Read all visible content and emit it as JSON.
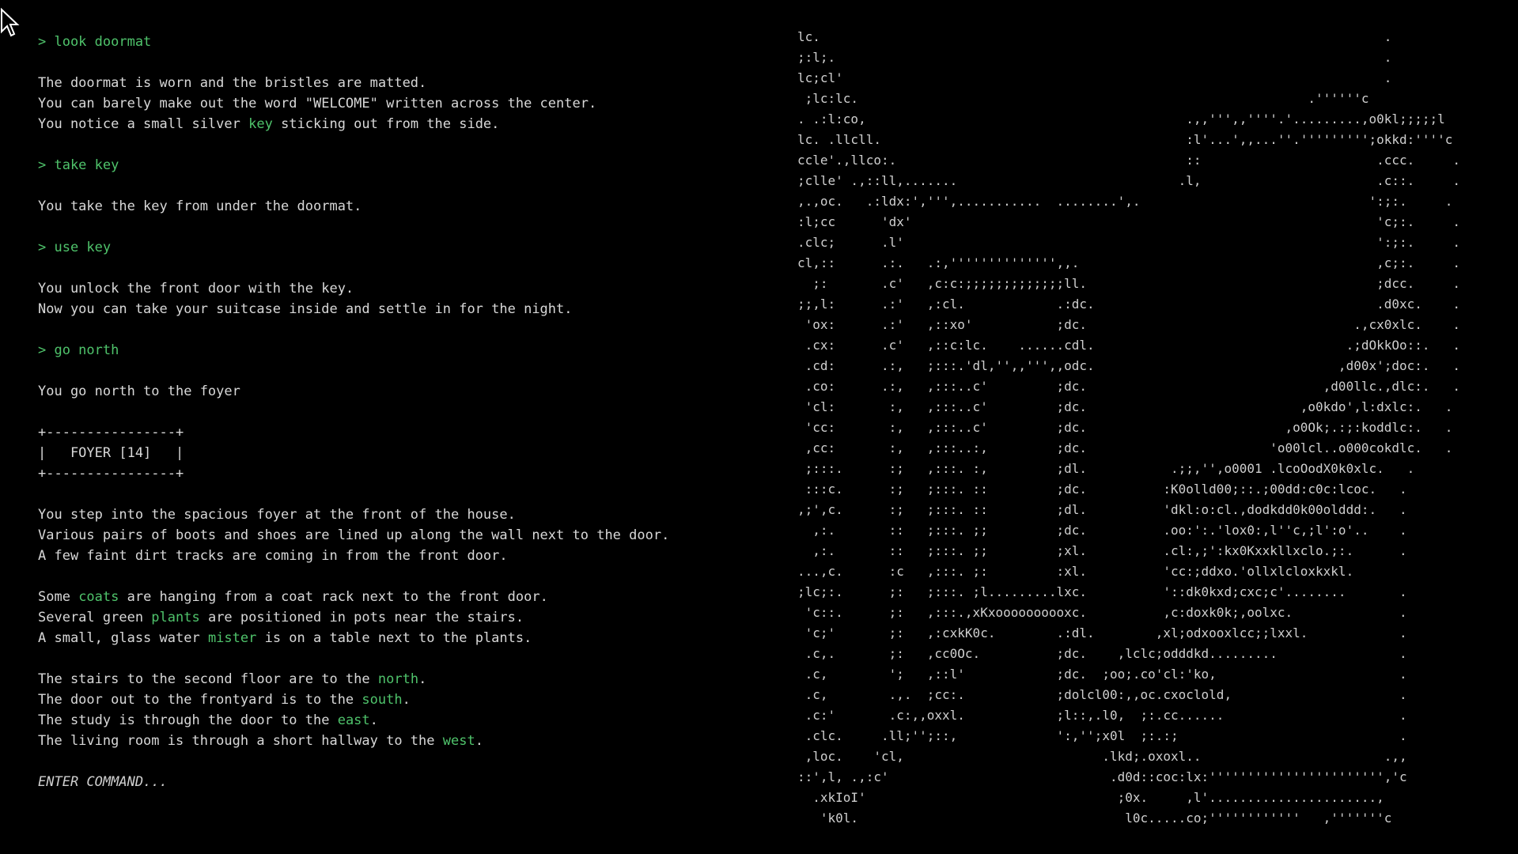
{
  "terminal": {
    "blocks": [
      {
        "type": "cmd",
        "text": "> look doormat"
      },
      {
        "type": "blank"
      },
      {
        "type": "text",
        "parts": [
          {
            "t": "The doormat is worn and the bristles are matted."
          }
        ]
      },
      {
        "type": "text",
        "parts": [
          {
            "t": "You can barely make out the word \"WELCOME\" written across the center."
          }
        ]
      },
      {
        "type": "text",
        "parts": [
          {
            "t": "You notice a small silver "
          },
          {
            "t": "key",
            "hl": true
          },
          {
            "t": " sticking out from the side."
          }
        ]
      },
      {
        "type": "blank"
      },
      {
        "type": "cmd",
        "text": "> take key"
      },
      {
        "type": "blank"
      },
      {
        "type": "text",
        "parts": [
          {
            "t": "You take the key from under the doormat."
          }
        ]
      },
      {
        "type": "blank"
      },
      {
        "type": "cmd",
        "text": "> use key"
      },
      {
        "type": "blank"
      },
      {
        "type": "text",
        "parts": [
          {
            "t": "You unlock the front door with the key."
          }
        ]
      },
      {
        "type": "text",
        "parts": [
          {
            "t": "Now you can take your suitcase inside and settle in for the night."
          }
        ]
      },
      {
        "type": "blank"
      },
      {
        "type": "cmd",
        "text": "> go north"
      },
      {
        "type": "blank"
      },
      {
        "type": "text",
        "parts": [
          {
            "t": "You go north to the foyer"
          }
        ]
      },
      {
        "type": "blank"
      },
      {
        "type": "box",
        "text": "+----------------+"
      },
      {
        "type": "box",
        "text": "|   FOYER [14]   |"
      },
      {
        "type": "box",
        "text": "+----------------+"
      },
      {
        "type": "blank"
      },
      {
        "type": "text",
        "parts": [
          {
            "t": "You step into the spacious foyer at the front of the house."
          }
        ]
      },
      {
        "type": "text",
        "parts": [
          {
            "t": "Various pairs of boots and shoes are lined up along the wall next to the door."
          }
        ]
      },
      {
        "type": "text",
        "parts": [
          {
            "t": "A few faint dirt tracks are coming in from the front door."
          }
        ]
      },
      {
        "type": "blank"
      },
      {
        "type": "text",
        "parts": [
          {
            "t": "Some "
          },
          {
            "t": "coats",
            "hl": true
          },
          {
            "t": " are hanging from a coat rack next to the front door."
          }
        ]
      },
      {
        "type": "text",
        "parts": [
          {
            "t": "Several green "
          },
          {
            "t": "plants",
            "hl": true
          },
          {
            "t": " are positioned in pots near the stairs."
          }
        ]
      },
      {
        "type": "text",
        "parts": [
          {
            "t": "A small, glass water "
          },
          {
            "t": "mister",
            "hl": true
          },
          {
            "t": " is on a table next to the plants."
          }
        ]
      },
      {
        "type": "blank"
      },
      {
        "type": "text",
        "parts": [
          {
            "t": "The stairs to the second floor are to the "
          },
          {
            "t": "north",
            "hl": true
          },
          {
            "t": "."
          }
        ]
      },
      {
        "type": "text",
        "parts": [
          {
            "t": "The door out to the frontyard is to the "
          },
          {
            "t": "south",
            "hl": true
          },
          {
            "t": "."
          }
        ]
      },
      {
        "type": "text",
        "parts": [
          {
            "t": "The study is through the door to the "
          },
          {
            "t": "east",
            "hl": true
          },
          {
            "t": "."
          }
        ]
      },
      {
        "type": "text",
        "parts": [
          {
            "t": "The living room is through a short hallway to the "
          },
          {
            "t": "west",
            "hl": true
          },
          {
            "t": "."
          }
        ]
      },
      {
        "type": "blank"
      },
      {
        "type": "prompt",
        "text": "ENTER COMMAND..."
      }
    ]
  },
  "ascii_art": [
    "lc.                                                                          .",
    ";:l;.                                                                        .",
    "lc;cl'                                                                       .",
    " ;lc:lc.                                                           .''''''c",
    ". .:l:co,                                          .,,''',,''''.'.........,o0kl;;;;;l",
    "lc. .llcll.                                        :l'...',,...''.''''''''';okkd:''''c",
    "ccle'.,llco:.                                      ::                       .ccc.     .",
    ";clle' .,::ll,.......                             .l,                       .c::.     .",
    ",.,oc.   .:ldx:',''',...........  ........',.                              ':;:.     .",
    ":l;cc      'dx'                                                             'c;:.     .",
    ".clc;      .l'                                                              ':;:.     .",
    "cl,::      .:.   .:,'''''''''''''',,.                                       ,c;:.     .",
    "  ;:       .c'   ,c:c:;;;;;;;;;;;;;ll.                                      ;dcc.     .",
    ";;,l:      .:'   ,:cl.            .:dc.                                     .d0xc.    .",
    " 'ox:      .:'   ,::xo'           ;dc.                                   .,cx0xlc.    .",
    " .cx:      .c'   ,::c:lc.    ......cdl.                                 .;dOkkOo::.   .",
    " .cd:      .:,   ;:::.'dl,'',,''',,odc.                                ,d00x';doc:.   .",
    " .co:      .:,   ,:::..c'         ;dc.                               ,d00llc.,dlc:.   .",
    " 'cl:       :,   ,:::..c'         ;dc.                            ,o0kdo',l:dxlc:.   .",
    " 'cc:       :,   ,:::..c'         ;dc.                          ,o0Ok;.:;:koddlc:.   .",
    " ,cc:       :,   ,:::..:,         ;dc.                        'o00lcl..o000cokdlc.   .",
    " ;:::.      :;   ,:::. :,         ;dl.           .;;,'',o0001 .lcoOodX0k0xlc.   .",
    " :::c.      :;   ;:::. ::         ;dc.          :K0olld00;::.;00dd:c0c:lcoc.   .",
    ",;',c.      :;   ;:::. ::         ;dl.          'dkl:o:cl.,dodkdd0k00olddd:.   .",
    "  ,:.       ::   ;:::. ;;         ;dc.          .oo:':.'lox0:,l''c,;l':o'..    .",
    "  ,:.       ::   ;:::. ;;         ;xl.          .cl:,;':kx0Kxxkllxclo.;:.      .",
    "...,c.      :c   ,:::. ;:         :xl.          'cc:;ddxo.'ollxlcloxkxkl.       ",
    ";lc;:.      ;:   ;:::. ;l.........lxc.          '::dk0kxd;cxc;c'........       .",
    " 'c::.      ;:   ,:::.,xKxoooooooooxc.          ,c:doxk0k;,oolxc.              .",
    " 'c;'       ;:   ,:cxkK0c.        .:dl.        ,xl;odxooxlcc;;lxxl.            .",
    " .c,.       ;:   ,cc0Oc.          ;dc.    ,lclc;odddkd.........                .",
    " .c,        ';   ,::l'            ;dc.  ;oo;.co'cl:'ko,                        .",
    " .c,        .,.  ;cc:.            ;dolcl00:,,oc.cxoclold,                      .",
    " .c:'       .c:,,oxxl.            ;l::,.l0,  ;:.cc......                       .",
    " .clc.     .ll;'';::,             ':,'';x0l  ;:.:;                             .",
    " ,loc.    'cl,                          .lkd;.oxoxl..                        .,,",
    "::',l, .,:c'                             .d0d::coc:lx:''''''''''''''''''''''','c",
    "  .xkIoI'                                 ;0x.     ,l'......................,",
    "   'k0l.                                   l0c.....co;''''''''''''   ,'''''''c"
  ]
}
